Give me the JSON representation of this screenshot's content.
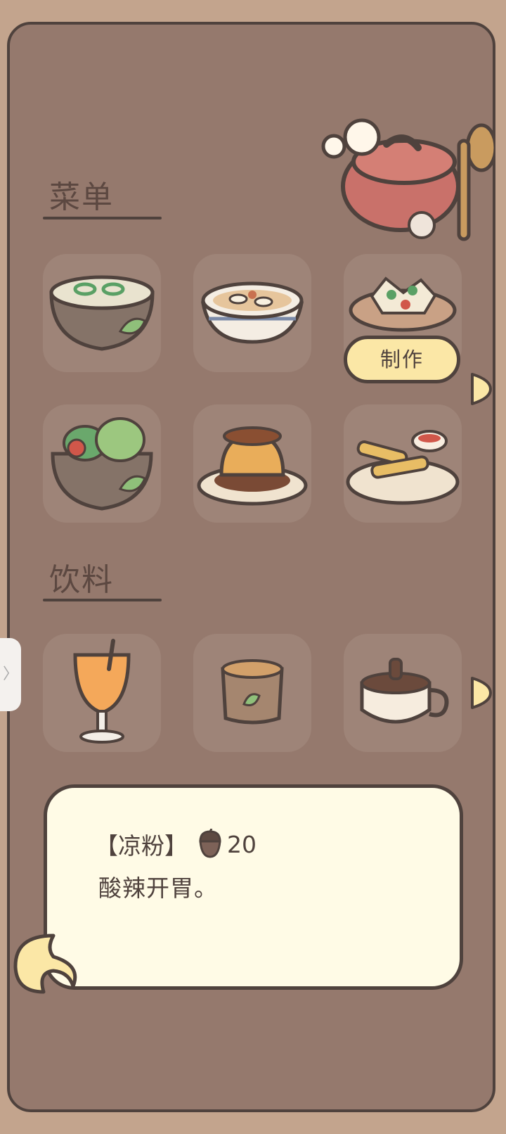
{
  "menu": {
    "section_title": "菜单",
    "dishes": [
      {
        "name": "soup-bowl",
        "icon": "soup-bowl-icon"
      },
      {
        "name": "noodle-bowl",
        "icon": "noodle-bowl-icon"
      },
      {
        "name": "liangfen-dish",
        "icon": "liangfen-dish-icon",
        "selected": true
      },
      {
        "name": "salad-bowl",
        "icon": "salad-bowl-icon"
      },
      {
        "name": "pudding",
        "icon": "pudding-icon"
      },
      {
        "name": "fries-plate",
        "icon": "fries-plate-icon"
      }
    ],
    "make_button": "制作"
  },
  "drinks": {
    "section_title": "饮料",
    "items": [
      {
        "name": "juice-glass",
        "icon": "juice-glass-icon"
      },
      {
        "name": "tea-cup",
        "icon": "tea-cup-icon"
      },
      {
        "name": "coffee-mug",
        "icon": "coffee-mug-icon"
      }
    ]
  },
  "side_tab": {
    "label": "〉"
  },
  "dialog": {
    "item_name": "【凉粉】",
    "currency_icon": "acorn-icon",
    "price": "20",
    "description": "酸辣开胃。"
  },
  "colors": {
    "background": "#c3a48d",
    "panel": "#95796d",
    "tile": "#9e8478",
    "outline": "#4f423d",
    "button": "#fbe7a6",
    "dialog": "#fffbe6"
  }
}
